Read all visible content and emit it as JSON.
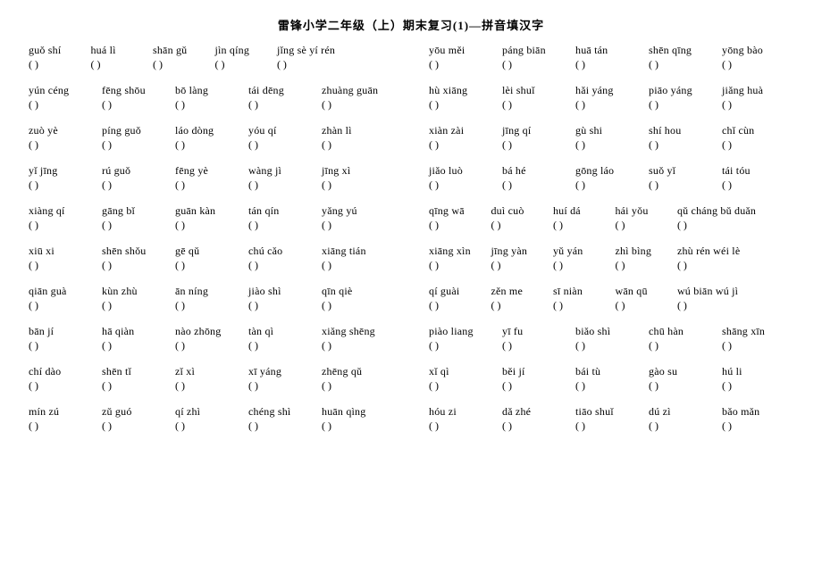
{
  "title": "雷锋小学二年级（上）期末复习(1)—拼音填汉字",
  "left": [
    {
      "items": [
        "guǒ shí",
        "huá lì",
        "shān gǔ",
        "jìn qíng",
        "jǐng sè yí rén"
      ],
      "wide": [
        4
      ]
    },
    {
      "items": [
        "yún céng",
        "fēng shōu",
        "bō làng",
        "tái dēng",
        "zhuàng guān"
      ],
      "wide": []
    },
    {
      "items": [
        "zuò yè",
        "píng guǒ",
        "láo dòng",
        "yóu qí",
        "zhàn lì"
      ],
      "wide": []
    },
    {
      "items": [
        "yǐ jīng",
        "rú guǒ",
        "fēng yè",
        "wàng jì",
        "jīng xì"
      ],
      "wide": []
    },
    {
      "items": [
        "xiàng qí",
        "gāng bǐ",
        "guān kàn",
        "tán qín",
        "yǎng yú"
      ],
      "wide": []
    },
    {
      "items": [
        "xiū xi",
        "shēn shǒu",
        "gē qǔ",
        "chú cǎo",
        "xiāng tián"
      ],
      "wide": []
    },
    {
      "items": [
        "qiān guà",
        "kùn zhù",
        "ān níng",
        "jiào shì",
        "qīn qiè"
      ],
      "wide": []
    },
    {
      "items": [
        "bān jí",
        "hā qiàn",
        "nào zhōng",
        "tàn qì",
        "xiǎng shēng"
      ],
      "wide": []
    },
    {
      "items": [
        "chí dào",
        "shēn tǐ",
        "zǐ xì",
        "xī yáng",
        "zhēng qǔ"
      ],
      "wide": []
    },
    {
      "items": [
        "mín zú",
        "zǔ guó",
        "qí zhì",
        "chéng shì",
        "huān qìng"
      ],
      "wide": []
    }
  ],
  "right": [
    {
      "items": [
        "yōu měi",
        "páng biān",
        "huā tán",
        "shēn qīng",
        "yōng bào"
      ],
      "wide": []
    },
    {
      "items": [
        "hù xiāng",
        "lèi shuǐ",
        "hǎi yáng",
        "piāo yáng",
        "jiǎng huà"
      ],
      "wide": []
    },
    {
      "items": [
        "xiàn zài",
        "jīng qí",
        "gù shi",
        "shí hou",
        "chǐ cùn"
      ],
      "wide": []
    },
    {
      "items": [
        "jiǎo luò",
        "bá hé",
        "gōng láo",
        "suǒ yǐ",
        "tái tóu"
      ],
      "wide": []
    },
    {
      "items": [
        "qīng wā",
        "duì cuò",
        "huí dá",
        "hái yǒu",
        "qǔ cháng bǔ duǎn"
      ],
      "wide": [
        4
      ]
    },
    {
      "items": [
        "xiāng xìn",
        "jīng yàn",
        "yǔ yán",
        "zhì bìng",
        "zhù rén wéi lè"
      ],
      "wide": [
        4
      ]
    },
    {
      "items": [
        "qí guài",
        "zěn me",
        "sī niàn",
        "wān qū",
        "wú biān wú jì"
      ],
      "wide": [
        4
      ]
    },
    {
      "items": [
        "piào liang",
        "yī fu",
        "biǎo shì",
        "chū hàn",
        "shāng xīn"
      ],
      "wide": []
    },
    {
      "items": [
        "xǐ qì",
        "běi jí",
        "bái tù",
        "gào su",
        "hú li"
      ],
      "wide": []
    },
    {
      "items": [
        "hóu zi",
        "dǎ zhé",
        "tiāo shuǐ",
        "dú zì",
        "bǎo mǎn"
      ],
      "wide": []
    }
  ],
  "paren_open": "(",
  "paren_close": ")"
}
